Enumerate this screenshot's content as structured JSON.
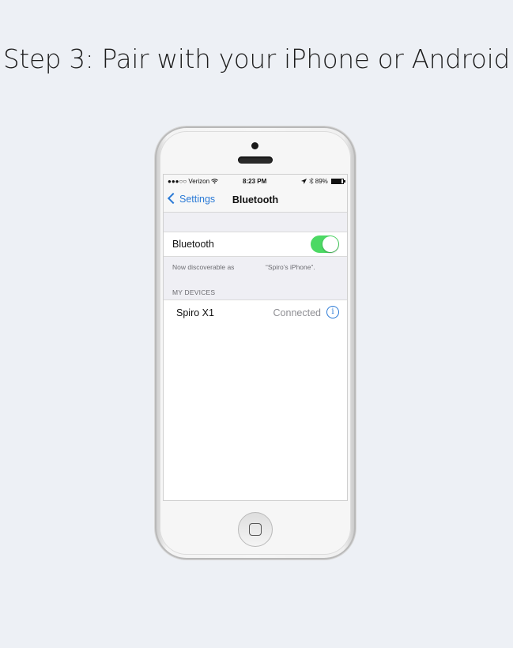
{
  "heading": "Step 3: Pair with your iPhone or Android",
  "status_bar": {
    "carrier": "●●●○○ Verizon",
    "wifi_icon": "wifi-icon",
    "time": "8:23 PM",
    "location_icon": "location-arrow-icon",
    "bluetooth_icon": "bluetooth-icon",
    "battery_percent": "89%",
    "battery_level": 0.89
  },
  "nav": {
    "back_label": "Settings",
    "title": "Bluetooth"
  },
  "bluetooth_row": {
    "label": "Bluetooth",
    "enabled": true,
    "toggle_color": "#4cd964"
  },
  "discoverable": {
    "text": "Now discoverable as",
    "name": "“Spiro’s iPhone”."
  },
  "my_devices": {
    "header": "MY DEVICES",
    "devices": [
      {
        "name": "Spiro X1",
        "status": "Connected"
      }
    ]
  },
  "colors": {
    "accent": "#2b7ad6",
    "background": "#edf0f5"
  }
}
